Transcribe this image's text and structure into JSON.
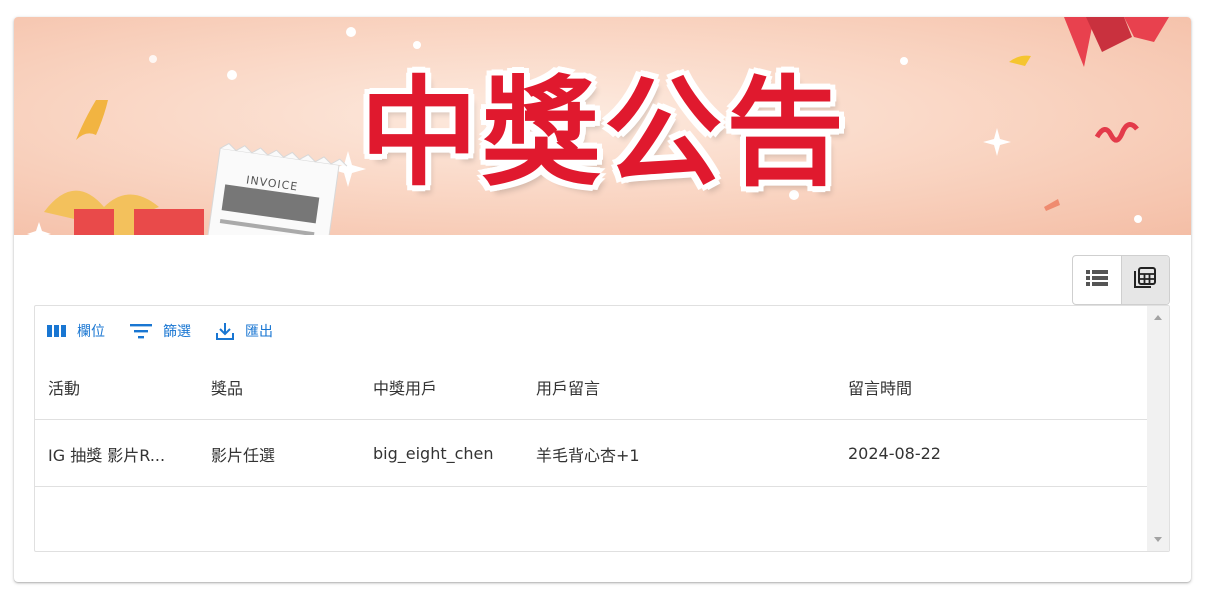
{
  "banner": {
    "title": "中獎公告",
    "invoice_label": "INVOICE"
  },
  "view_toggle": {
    "list_icon": "list-view-icon",
    "grid_icon": "table-view-icon",
    "active": "table"
  },
  "toolbar": {
    "columns_label": "欄位",
    "filter_label": "篩選",
    "export_label": "匯出",
    "columns_icon": "columns-icon",
    "filter_icon": "filter-icon",
    "export_icon": "download-icon"
  },
  "table": {
    "headers": [
      "活動",
      "獎品",
      "中獎用戶",
      "用戶留言",
      "留言時間"
    ],
    "rows": [
      {
        "activity": "IG 抽獎 影片R...",
        "prize": "影片任選",
        "user": "big_eight_chen",
        "comment": "羊毛背心杏+1",
        "time": "2024-08-22"
      }
    ]
  },
  "colors": {
    "accent": "#1976d2",
    "banner_title": "#e0192e",
    "banner_bg": "#f9d3c0"
  }
}
